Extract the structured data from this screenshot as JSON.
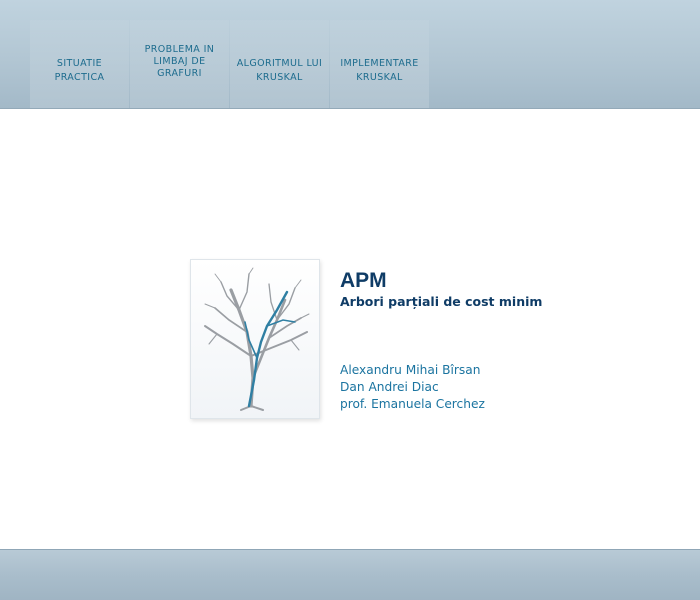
{
  "nav": {
    "items": [
      {
        "label_lines": [
          "SITUATIE",
          "PRACTICA"
        ]
      },
      {
        "label_lines": [
          "PROBLEMA IN",
          "LIMBAJ DE",
          "GRAFURI"
        ]
      },
      {
        "label_lines": [
          "ALGORITMUL LUI",
          "KRUSKAL"
        ]
      },
      {
        "label_lines": [
          "IMPLEMENTARE",
          "KRUSKAL"
        ]
      }
    ]
  },
  "main": {
    "title": "APM",
    "subtitle": "Arbori parțiali de cost minim",
    "authors": [
      "Alexandru Mihai Bîrsan",
      "Dan Andrei Diac",
      "prof. Emanuela Cerchez"
    ]
  },
  "colors": {
    "title": "#0f3c66",
    "author": "#1b74a0",
    "nav_text": "#1d6c8e",
    "tree_gray": "#9a9ea3",
    "tree_blue": "#2f7fa3"
  }
}
